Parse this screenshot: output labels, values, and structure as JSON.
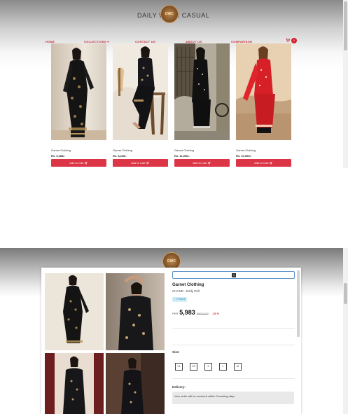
{
  "shop": {
    "brand": "DAILY WEAR CASUAL",
    "logo_text": "DWC",
    "nav": [
      "HOME",
      "COLLECTIONS ▾",
      "CONTACT US",
      "ABOUT US",
      "COMPARISON"
    ],
    "cart_count": "0"
  },
  "products": [
    {
      "name": "Garnet Clothing",
      "price": "Rs. 6,983/-",
      "button": "Add to Cart"
    },
    {
      "name": "Garnet Clothing",
      "price": "Rs. 8,236/-",
      "button": "Add to Cart"
    },
    {
      "name": "Garnet Clothing",
      "price": "Rs. 11,900/-",
      "button": "Add to Cart"
    },
    {
      "name": "Garnet Clothing",
      "price": "Rs. 10,900/-",
      "button": "Add to Cart"
    }
  ],
  "modal": {
    "title": "Garnet Clothing",
    "subtitle": "CHAND - Daily Prêt",
    "stock": "In Stock",
    "currency": "PKR",
    "price": "5,983",
    "old_price": "PKR 6,973",
    "discount": "-15 %",
    "size_label": "Size:",
    "sizes": [
      "XL",
      "XS",
      "S",
      "L",
      "M"
    ],
    "delivery_label": "Delivery:",
    "delivery_text": "Your order will be received within 3 working days"
  },
  "colors": {
    "accent": "#dc3545",
    "nav_text": "#c4242f"
  }
}
